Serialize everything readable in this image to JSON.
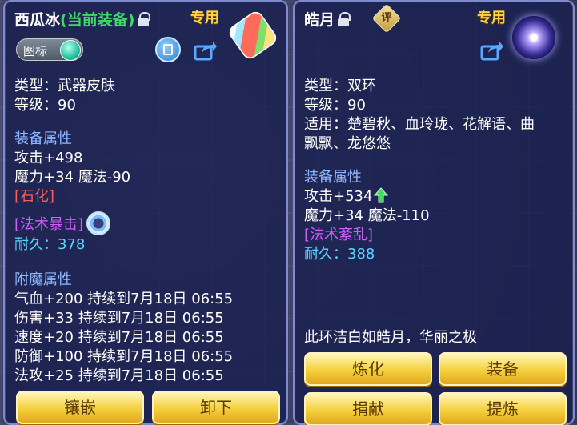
{
  "left_panel": {
    "title_name": "西瓜冰",
    "title_equipped": "(当前装备)",
    "exclusive_label": "专用",
    "toggle_label": "图标",
    "type_line": "类型：武器皮肤",
    "level_line": "等级：90",
    "equip_attr_title": "装备属性",
    "attack_line": "攻击+498",
    "magic_line": "魔力+34 魔法-90",
    "petrify_tag": "[石化]",
    "spell_crit_tag": "[法术暴击]",
    "durability_line": "耐久：378",
    "enchant_title": "附魔属性",
    "enchant_lines": [
      "气血+200 持续到7月18日 06:55",
      "伤害+33 持续到7月18日 06:55",
      "速度+20 持续到7月18日 06:55",
      "防御+100 持续到7月18日 06:55",
      "法攻+25 持续到7月18日 06:55"
    ],
    "buttons": {
      "inlay": "镶嵌",
      "unequip": "卸下"
    }
  },
  "right_panel": {
    "title_name": "皓月",
    "rating_label": "评",
    "exclusive_label": "专用",
    "type_line": "类型：双环",
    "level_line": "等级：90",
    "applies_line1": "适用：楚碧秋、血玲珑、花解语、曲",
    "applies_line2": "飘飘、龙悠悠",
    "equip_attr_title": "装备属性",
    "attack_line": "攻击+534",
    "magic_line": "魔力+34 魔法-110",
    "spell_tag": "[法术紊乱]",
    "durability_line": "耐久：388",
    "description": "此环洁白如皓月，华丽之极",
    "buttons": {
      "refine": "炼化",
      "equip": "装备",
      "donate": "捐献",
      "extract": "提炼"
    }
  },
  "icons": {
    "lock": "lock-icon",
    "share": "share-icon",
    "archive": "archive-icon",
    "up_arrow": "up-arrow-icon",
    "spin": "spell-crit-swirl-icon"
  },
  "colors": {
    "title_equipped": "#3fd96a",
    "exclusive": "#ffd24a",
    "section_title": "#8fb7ff",
    "petrify": "#ff5b5b",
    "magic_tag": "#d35cff",
    "durability": "#59d6ff",
    "button_gold": "#f5cf3c"
  }
}
